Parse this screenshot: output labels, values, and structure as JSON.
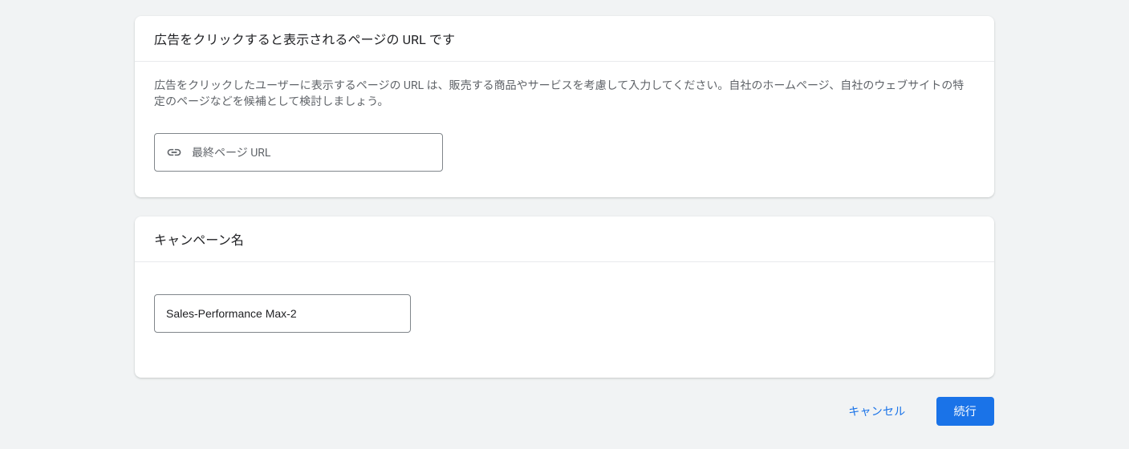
{
  "url_section": {
    "title": "広告をクリックすると表示されるページの URL です",
    "description": "広告をクリックしたユーザーに表示するページの URL は、販売する商品やサービスを考慮して入力してください。自社のホームページ、自社のウェブサイトの特定のページなどを候補として検討しましょう。",
    "input_placeholder": "最終ページ URL"
  },
  "campaign_section": {
    "title": "キャンペーン名",
    "input_value": "Sales-Performance Max-2"
  },
  "buttons": {
    "cancel": "キャンセル",
    "continue": "続行"
  }
}
